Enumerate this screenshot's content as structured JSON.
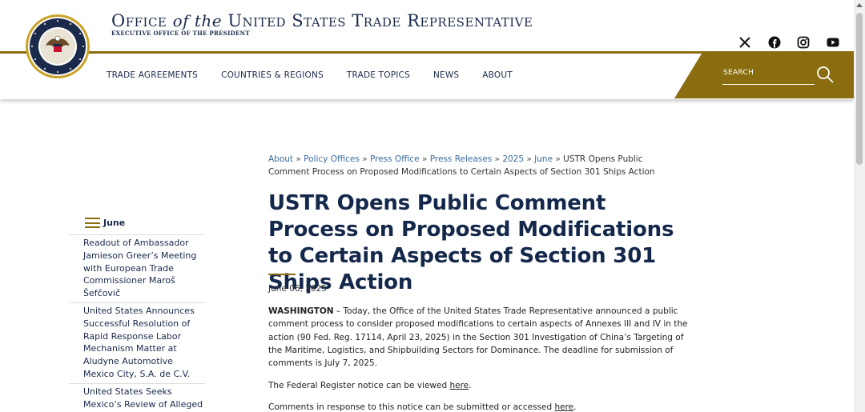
{
  "header": {
    "title_office": "Office",
    "title_of_the": "of the",
    "title_united": "United",
    "title_states": "States",
    "title_trade": "Trade",
    "title_representative": "Representative",
    "subtitle": "EXECUTIVE OFFICE OF THE PRESIDENT",
    "seal_text": "EXECUTIVE OFFICE OF THE PRESIDENT OF THE UNITED STATES"
  },
  "social": [
    "x-icon",
    "facebook-icon",
    "instagram-icon",
    "youtube-icon"
  ],
  "nav": {
    "items": [
      "TRADE AGREEMENTS",
      "COUNTRIES & REGIONS",
      "TRADE TOPICS",
      "NEWS",
      "ABOUT"
    ]
  },
  "search": {
    "label": "SEARCH"
  },
  "colors": {
    "navy": "#14284b",
    "gold": "#8a6d0f",
    "link": "#3a6aa0"
  },
  "sidebar": {
    "heading": "June",
    "items": [
      "Readout of Ambassador Jamieson Greer’s Meeting with European Trade Commissioner Maroš Šefčovič",
      "United States Announces Successful Resolution of Rapid Response Labor Mechanism Matter at Aludyne Automotive Mexico City, S.A. de C.V.",
      "United States Seeks Mexico’s Review of Alleged Denial of Workers’ Rights"
    ]
  },
  "breadcrumb": {
    "links": [
      "About",
      "Policy Offices",
      "Press Office",
      "Press Releases",
      "2025",
      "June"
    ],
    "separator": "»",
    "current": "USTR Opens Public Comment Process on Proposed Modifications to Certain Aspects of Section 301 Ships Action"
  },
  "article": {
    "title": "USTR Opens Public Comment Process on Proposed Modifications to Certain Aspects of Section 301 Ships Action",
    "date": "June 06, 2025",
    "p1_lead": "WASHINGTON",
    "p1_body": " – Today, the Office of the United States Trade Representative announced a public comment process to consider proposed modifications to certain aspects of Annexes III and IV in the action (90 Fed. Reg. 17114, April 23, 2025) in the Section 301 Investigation of China’s Targeting of the Maritime, Logistics, and Shipbuilding Sectors for Dominance. The deadline for submission of comments is July 7, 2025.",
    "p2_text": "The Federal Register notice can be viewed ",
    "p2_link": "here",
    "p2_end": ".",
    "p3_text": "Comments in response to this notice can be submitted or accessed ",
    "p3_link": "here",
    "p3_end": "."
  }
}
